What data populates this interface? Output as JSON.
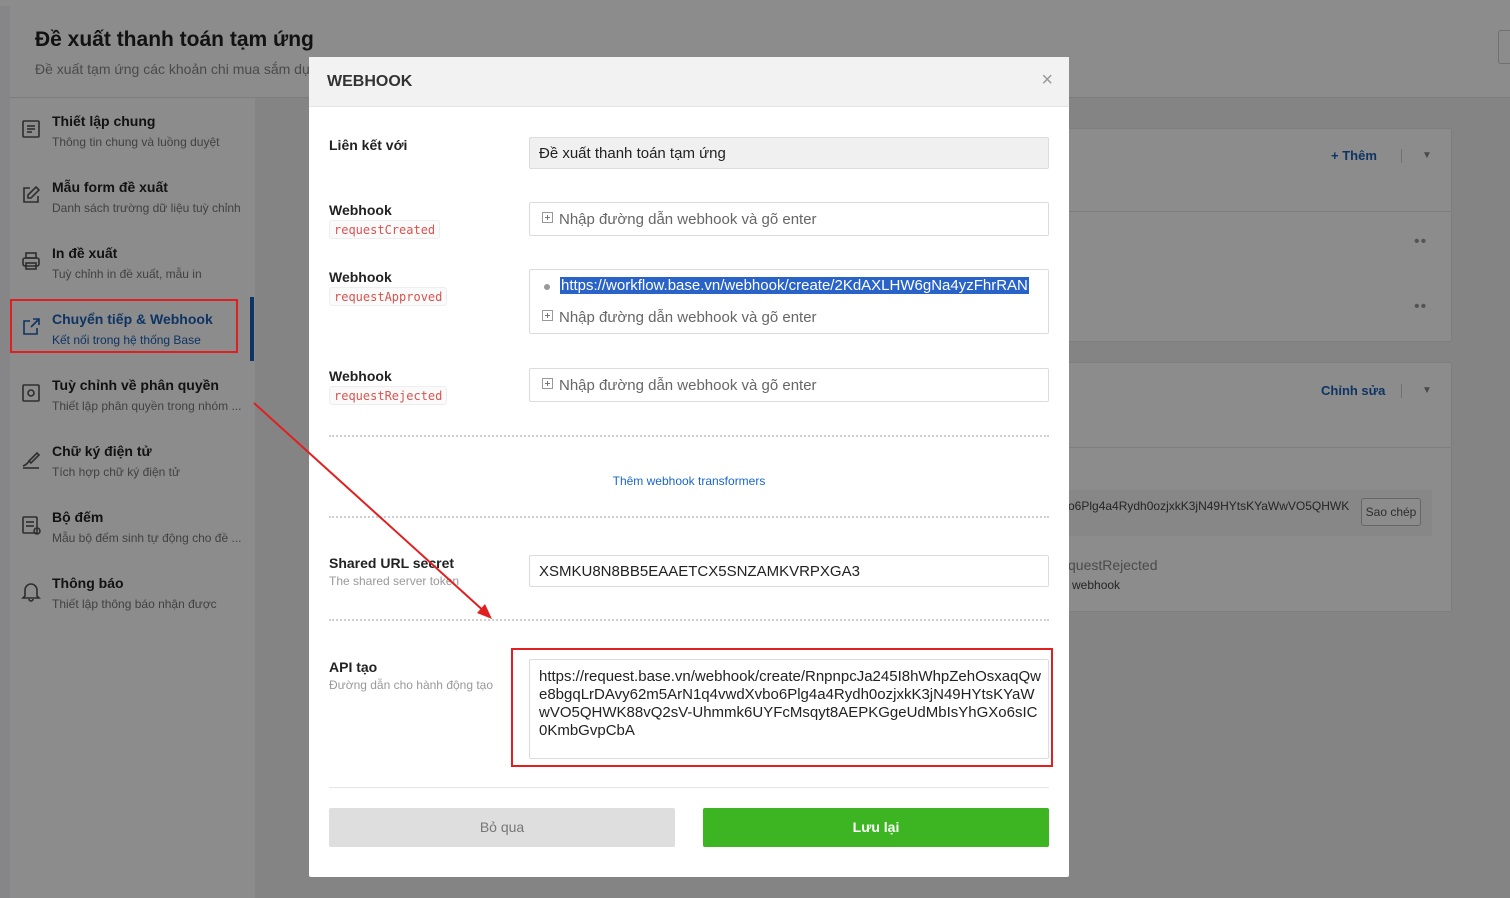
{
  "background": {
    "page_title": "Đề xuất thanh toán tạm ứng",
    "page_subtitle": "Đề xuất tạm ứng các khoản chi mua sắm dụ",
    "sidebar": [
      {
        "label": "Thiết lập chung",
        "sub": "Thông tin chung và luồng duyệt",
        "icon": "document-icon"
      },
      {
        "label": "Mẫu form đề xuất",
        "sub": "Danh sách trường dữ liệu tuỳ chỉnh",
        "icon": "edit-form-icon"
      },
      {
        "label": "In đề xuất",
        "sub": "Tuỳ chỉnh in đề xuất, mẫu in",
        "icon": "printer-icon"
      },
      {
        "label": "Chuyển tiếp & Webhook",
        "sub": "Kết nối trong hệ thống Base",
        "icon": "share-icon",
        "active": true
      },
      {
        "label": "Tuỳ chỉnh về phân quyền",
        "sub": "Thiết lập phân quyền trong nhóm ...",
        "icon": "permission-icon"
      },
      {
        "label": "Chữ ký điện tử",
        "sub": "Tích hợp chữ ký điện tử",
        "icon": "signature-icon"
      },
      {
        "label": "Bộ đếm",
        "sub": "Mẫu bộ đếm sinh tự động cho đề ...",
        "icon": "counter-icon"
      },
      {
        "label": "Thông báo",
        "sub": "Thiết lập thông báo nhận được",
        "icon": "bell-icon"
      }
    ],
    "card1_action": "+ Thêm",
    "card2_action": "Chỉnh sửa",
    "secret_partial": "o6Plg4a4Rydh0ozjxkK3jN49HYtsKYaWwVO5QHWK",
    "copy_label": "Sao chép",
    "event_partial": "questRejected",
    "event_sub_partial": "webhook"
  },
  "modal": {
    "title": "WEBHOOK",
    "close_symbol": "×",
    "linked_label": "Liên kết với",
    "linked_value": "Đề xuất thanh toán tạm ứng",
    "webhooks": [
      {
        "label": "Webhook",
        "event": "requestCreated",
        "urls": [],
        "placeholder": "Nhập đường dẫn webhook và gõ enter"
      },
      {
        "label": "Webhook",
        "event": "requestApproved",
        "urls": [
          "https://workflow.base.vn/webhook/create/2KdAXLHW6gNa4yzFhrRAN"
        ],
        "placeholder": "Nhập đường dẫn webhook và gõ enter"
      },
      {
        "label": "Webhook",
        "event": "requestRejected",
        "urls": [],
        "placeholder": "Nhập đường dẫn webhook và gõ enter"
      }
    ],
    "transformers_link": "Thêm webhook transformers",
    "secret_label": "Shared URL secret",
    "secret_sub": "The shared server token",
    "secret_value": "XSMKU8N8BB5EAAETCX5SNZAMKVRPXGA3",
    "api_label": "API tạo",
    "api_sub": "Đường dẫn cho hành động tạo",
    "api_value": "https://request.base.vn/webhook/create/RnpnpcJa245I8hWhpZehOsxaqQwe8bgqLrDAvy62m5ArN1q4vwdXvbo6Plg4a4Rydh0ozjxkK3jN49HYtsKYaWwVO5QHWK88vQ2sV-Uhmmk6UYFcMsqyt8AEPKGgeUdMbIsYhGXo6sIC0KmbGvpCbA",
    "cancel_label": "Bỏ qua",
    "save_label": "Lưu lại"
  },
  "colors": {
    "accent_blue": "#1a5fb4",
    "save_green": "#3db422",
    "highlight_red": "#e02020",
    "code_red": "#d9534f"
  }
}
